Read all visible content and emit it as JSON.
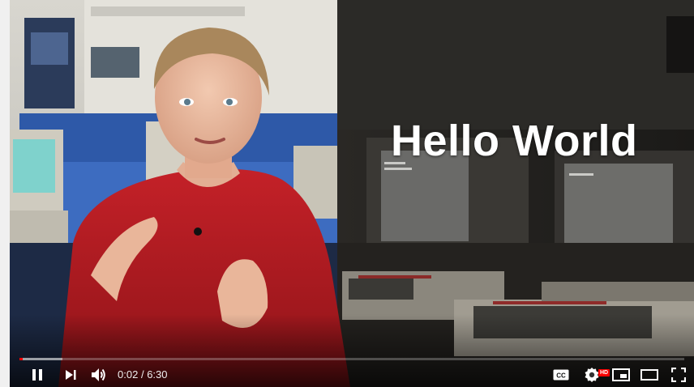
{
  "video": {
    "overlay_title": "Hello World",
    "progress": 0.005,
    "buffered": 0.065
  },
  "controls": {
    "time_current": "0:02",
    "time_separator": "/",
    "time_total": "6:30",
    "play_state": "playing",
    "icons": {
      "pause": "pause-icon",
      "next": "next-icon",
      "volume": "volume-icon",
      "captions": "captions-icon",
      "settings": "settings-icon",
      "miniplayer": "miniplayer-icon",
      "theater": "theater-mode-icon",
      "fullscreen": "fullscreen-icon"
    },
    "settings_badge": "HD"
  },
  "colors": {
    "progress_played": "#ff0000",
    "hd_badge": "#ff0000",
    "shirt": "#b51f24"
  }
}
